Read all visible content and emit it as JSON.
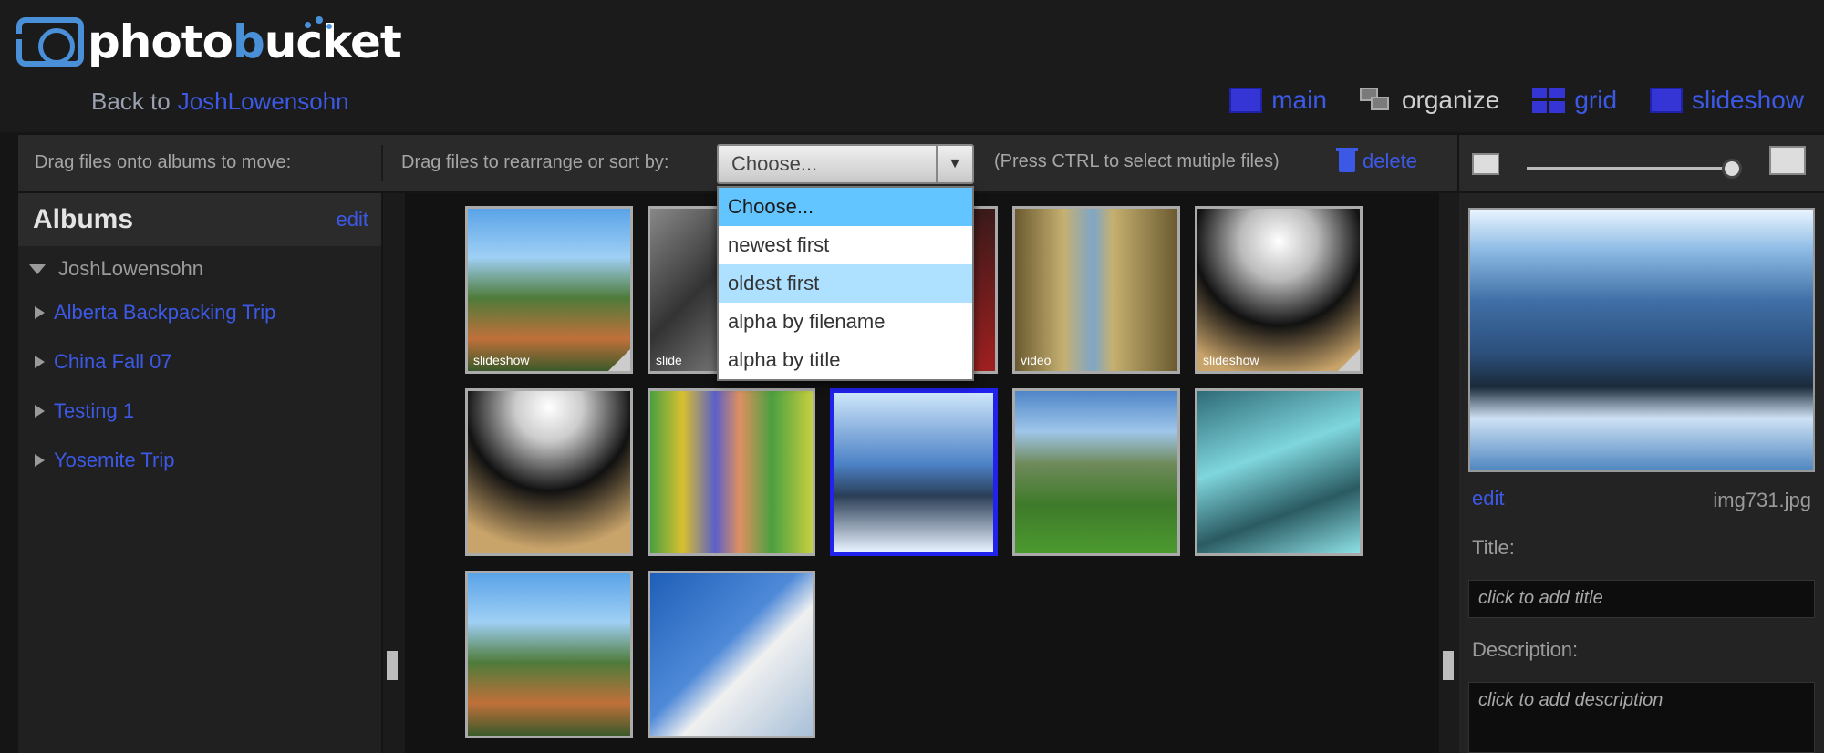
{
  "brand": {
    "name_prefix": "photo",
    "name_b": "b",
    "name_suffix": "ucket"
  },
  "header": {
    "back_label": "Back to",
    "back_user": "JoshLowensohn"
  },
  "views": {
    "main": "main",
    "organize": "organize",
    "grid": "grid",
    "slideshow": "slideshow"
  },
  "toolbar": {
    "move_hint": "Drag files onto albums to move:",
    "sort_hint": "Drag files to rearrange or sort by:",
    "sort_value": "Choose...",
    "ctrl_hint": "(Press CTRL to select mutiple files)",
    "delete_label": "delete"
  },
  "sort_options": [
    "Choose...",
    "newest first",
    "oldest first",
    "alpha by filename",
    "alpha by title"
  ],
  "sidebar": {
    "title": "Albums",
    "edit": "edit",
    "root": "JoshLowensohn",
    "albums": [
      "Alberta Backpacking Trip",
      "China Fall 07",
      "Testing 1",
      "Yosemite Trip"
    ]
  },
  "grid": {
    "captions": {
      "t1": "slideshow",
      "t2": "slide",
      "t4": "video",
      "t5": "slideshow"
    }
  },
  "detail": {
    "edit": "edit",
    "filename": "img731.jpg",
    "title_label": "Title:",
    "title_placeholder": "click to add title",
    "desc_label": "Description:",
    "desc_placeholder": "click to add description"
  },
  "colors": {
    "link": "#3c59e6",
    "selected_border": "#2222ee",
    "dropdown_highlight": "#aee0ff"
  }
}
